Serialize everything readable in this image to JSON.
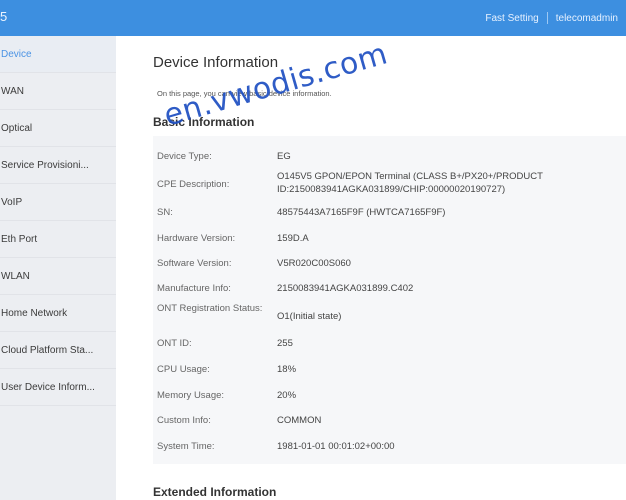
{
  "header": {
    "brand": "5",
    "fast_setting": "Fast Setting",
    "user": "telecomadmin"
  },
  "sidebar": {
    "items": [
      {
        "label": "Device"
      },
      {
        "label": "WAN"
      },
      {
        "label": "Optical"
      },
      {
        "label": "Service Provisioni..."
      },
      {
        "label": "VoIP"
      },
      {
        "label": "Eth Port"
      },
      {
        "label": "WLAN"
      },
      {
        "label": "Home Network"
      },
      {
        "label": "Cloud Platform Sta..."
      },
      {
        "label": "User Device Inform..."
      }
    ]
  },
  "main": {
    "title": "Device Information",
    "description": "On this page, you can view basic device information.",
    "basic_title": "Basic Information",
    "extended_title": "Extended Information",
    "rows": [
      {
        "label": "Device Type:",
        "value": "EG"
      },
      {
        "label": "CPE Description:",
        "value": "O145V5 GPON/EPON Terminal (CLASS B+/PX20+/PRODUCT ID:2150083941AGKA031899/CHIP:00000020190727)"
      },
      {
        "label": "SN:",
        "value": "48575443A7165F9F (HWTCA7165F9F)"
      },
      {
        "label": "Hardware Version:",
        "value": "159D.A"
      },
      {
        "label": "Software Version:",
        "value": "V5R020C00S060"
      },
      {
        "label": "Manufacture Info:",
        "value": "2150083941AGKA031899.C402"
      },
      {
        "label": "ONT Registration Status:",
        "value": "O1(Initial state)"
      },
      {
        "label": "ONT ID:",
        "value": "255"
      },
      {
        "label": "CPU Usage:",
        "value": "18%"
      },
      {
        "label": "Memory Usage:",
        "value": "20%"
      },
      {
        "label": "Custom Info:",
        "value": "COMMON"
      },
      {
        "label": "System Time:",
        "value": "1981-01-01 00:01:02+00:00"
      }
    ]
  },
  "watermark": "en.vwodis.com",
  "colors": {
    "header_bg": "#3d8fe0",
    "active_item": "#4b93e4",
    "watermark": "#1e4fc2"
  }
}
